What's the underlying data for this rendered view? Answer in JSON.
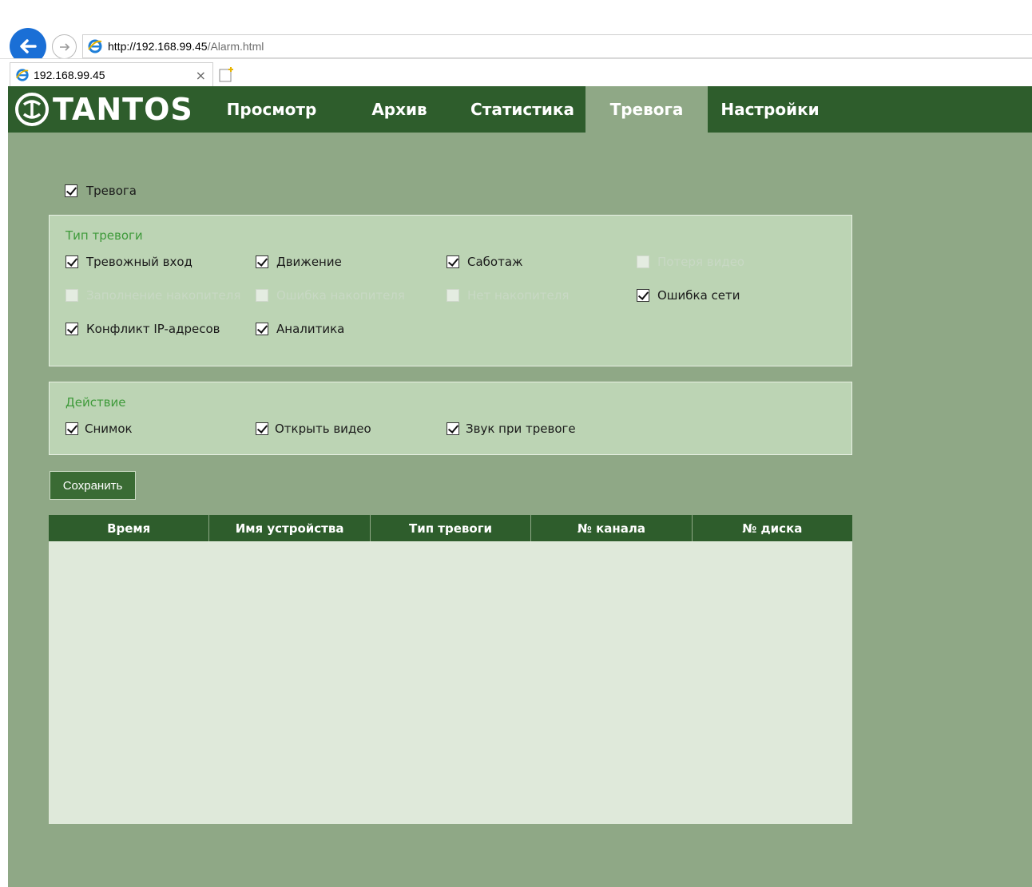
{
  "browser": {
    "url_host": "http://192.168.99.45",
    "url_path": "/Alarm.html",
    "tab_title": "192.168.99.45",
    "tab_close": "×"
  },
  "nav": {
    "logo": "TANTOS",
    "items": [
      {
        "label": "Просмотр",
        "active": false
      },
      {
        "label": "Архив",
        "active": false
      },
      {
        "label": "Статистика",
        "active": false
      },
      {
        "label": "Тревога",
        "active": true
      },
      {
        "label": "Настройки",
        "active": false
      }
    ]
  },
  "alarm_toggle": {
    "label": "Тревога",
    "checked": true
  },
  "alarm_type": {
    "title": "Тип тревоги",
    "options": [
      {
        "label": "Тревожный вход",
        "checked": true,
        "disabled": false
      },
      {
        "label": "Движение",
        "checked": true,
        "disabled": false
      },
      {
        "label": "Саботаж",
        "checked": true,
        "disabled": false
      },
      {
        "label": "Потеря видео",
        "checked": false,
        "disabled": true
      },
      {
        "label": "Заполнение накопителя",
        "checked": false,
        "disabled": true
      },
      {
        "label": "Ошибка накопителя",
        "checked": false,
        "disabled": true
      },
      {
        "label": "Нет накопителя",
        "checked": false,
        "disabled": true
      },
      {
        "label": "Ошибка сети",
        "checked": true,
        "disabled": false
      },
      {
        "label": "Конфликт IP-адресов",
        "checked": true,
        "disabled": false
      },
      {
        "label": "Аналитика",
        "checked": true,
        "disabled": false
      }
    ]
  },
  "action": {
    "title": "Действие",
    "options": [
      {
        "label": "Снимок",
        "checked": true
      },
      {
        "label": "Открыть видео",
        "checked": true
      },
      {
        "label": "Звук при тревоге",
        "checked": true
      }
    ]
  },
  "save_label": "Сохранить",
  "table": {
    "columns": [
      "Время",
      "Имя устройства",
      "Тип тревоги",
      "№ канала",
      "№ диска"
    ],
    "rows": []
  },
  "colors": {
    "nav_bg": "#2e5d2c",
    "page_bg": "#8fa886",
    "panel_bg": "#bcd4b4",
    "panel_title": "#3e9a3a",
    "table_body": "#dfe9da"
  }
}
